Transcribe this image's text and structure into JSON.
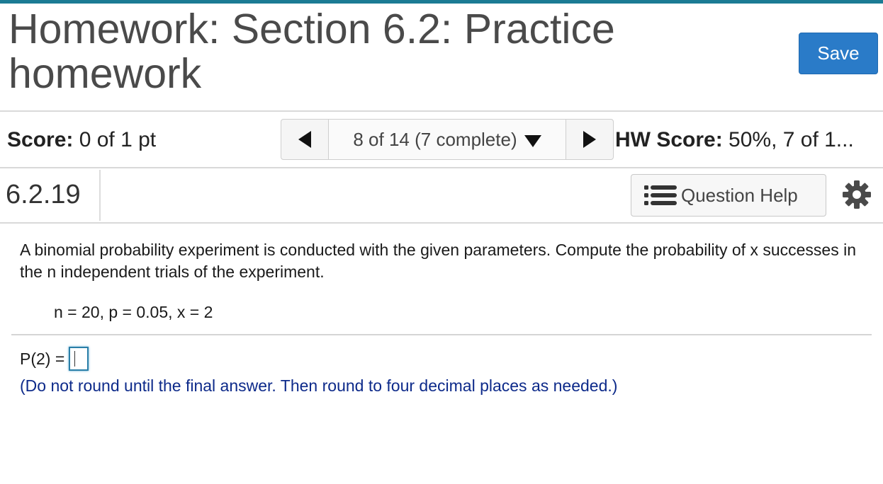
{
  "header": {
    "title": "Homework: Section 6.2: Practice homework",
    "save_label": "Save"
  },
  "status": {
    "score_label": "Score:",
    "score_value": " 0 of 1 pt",
    "nav_position": "8 of 14 (7 complete)",
    "hw_score_label": "HW Score:",
    "hw_score_value": " 50%, 7 of 1..."
  },
  "question": {
    "number": "6.2.19",
    "help_label": "Question Help",
    "prompt": "A binomial probability experiment is conducted with the given parameters. Compute the probability of x successes in the n independent trials of the experiment.",
    "parameters": "n = 20, p = 0.05, x = 2",
    "answer_label": "P(2) =",
    "answer_value": "",
    "instruction": "(Do not round until the final answer. Then round to four decimal places as needed.)"
  },
  "colors": {
    "accent_bar": "#1b7b94",
    "save_button": "#2a7bc8",
    "instruction_text": "#0d2a8a"
  },
  "icons": {
    "prev": "triangle-left-icon",
    "next": "triangle-right-icon",
    "dropdown": "triangle-down-icon",
    "help": "list-icon",
    "settings": "gear-icon"
  }
}
